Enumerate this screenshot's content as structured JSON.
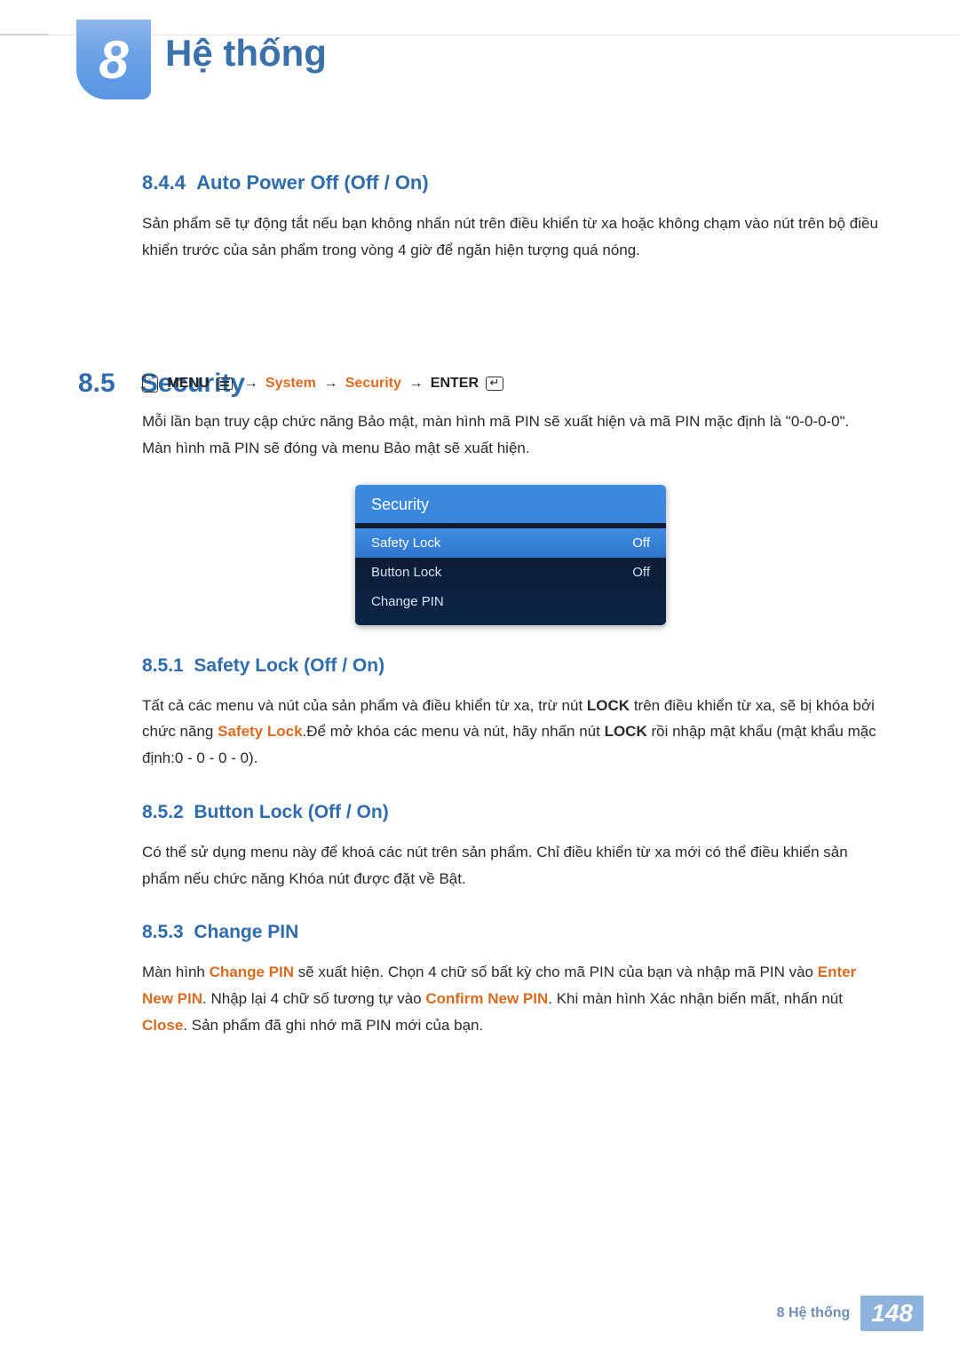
{
  "chapter": {
    "number": "8",
    "title": "Hệ thống"
  },
  "sec844": {
    "heading_no": "8.4.4",
    "heading_title": "Auto Power Off (Off / On)",
    "body": "Sản phẩm sẽ tự động tắt nếu bạn không nhấn nút trên điều khiển từ xa hoặc không chạm vào nút trên bộ điều khiển trước của sản phẩm trong vòng 4 giờ để ngăn hiện tượng quá nóng."
  },
  "sec85": {
    "no": "8.5",
    "title": "Security",
    "nav": {
      "menu_label": "MENU",
      "path1": "System",
      "path2": "Security",
      "enter_label": "ENTER",
      "arrow": "→"
    },
    "intro": "Mỗi lần bạn truy cập chức năng Bảo mật, màn hình mã PIN sẽ xuất hiện và mã PIN mặc định là \"0-0-0-0\". Màn hình mã PIN sẽ đóng và menu Bảo mật sẽ xuất hiện.",
    "osd": {
      "title": "Security",
      "rows": [
        {
          "label": "Safety Lock",
          "value": "Off"
        },
        {
          "label": "Button Lock",
          "value": "Off"
        },
        {
          "label": "Change PIN",
          "value": ""
        }
      ]
    }
  },
  "sec851": {
    "heading_no": "8.5.1",
    "heading_title": "Safety Lock (Off / On)",
    "p_pre": "Tất cả các menu và nút của sản phẩm và điều khiển từ xa, trừ nút ",
    "lock1": "LOCK",
    "p_mid1": " trên điều khiển từ xa, sẽ bị khóa bởi chức năng ",
    "safety_lock": "Safety Lock",
    "p_mid2": ".Để mở khóa các menu và nút, hãy nhấn nút ",
    "lock2": "LOCK",
    "p_post": " rồi nhập mật khẩu (mật khẩu mặc định:0 - 0 - 0 - 0)."
  },
  "sec852": {
    "heading_no": "8.5.2",
    "heading_title": "Button Lock (Off / On)",
    "body": "Có thể sử dụng menu này để khoá các nút trên sản phẩm. Chỉ điều khiển từ xa mới có thể điều khiển sản phẩm nếu chức năng Khóa nút được đặt về Bật."
  },
  "sec853": {
    "heading_no": "8.5.3",
    "heading_title": "Change PIN",
    "p1_pre": "Màn hình ",
    "p1_changepin": "Change PIN",
    "p1_mid": " sẽ xuất hiện. Chọn 4 chữ số bất kỳ cho mã PIN của bạn và nhập mã PIN vào ",
    "p1_enter": "Enter New PIN",
    "p1_mid2": ". Nhập lại 4 chữ số tương tự vào ",
    "p1_confirm": "Confirm New PIN",
    "p1_mid3": ". Khi màn hình Xác nhận biến mất, nhấn nút ",
    "p1_close": "Close",
    "p1_post": ". Sản phẩm đã ghi nhớ mã PIN mới của bạn."
  },
  "footer": {
    "label": "8 Hệ thống",
    "page": "148"
  }
}
